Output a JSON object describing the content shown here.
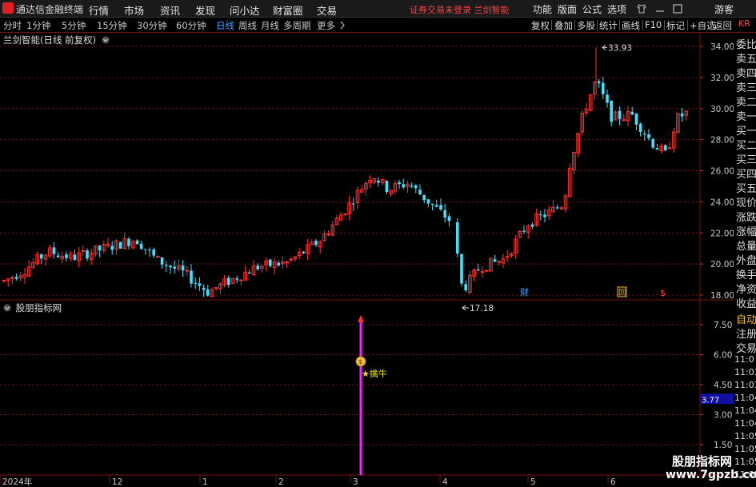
{
  "titlebar": {
    "app_name": "通达信金融终端",
    "menus": [
      "行情",
      "市场",
      "资讯",
      "发现",
      "问小达",
      "财富圈",
      "交易"
    ],
    "warning": "证券交易未登录  兰剑智能",
    "right_menus": [
      "功能",
      "版面",
      "公式",
      "选项"
    ],
    "user": "游客"
  },
  "periods": [
    "分时",
    "1分钟",
    "5分钟",
    "15分钟",
    "30分钟",
    "60分钟",
    "日线",
    "周线",
    "月线",
    "多周期",
    "更多"
  ],
  "active_period": "日线",
  "toolbar": [
    "复权",
    "叠加",
    "多股",
    "统计",
    "画线",
    "F10",
    "标记",
    "+自选",
    "返回"
  ],
  "kr_tag": "KR",
  "chart": {
    "title": "兰剑智能(日线 前复权)",
    "price_ticks": [
      "34.00",
      "32.00",
      "30.00",
      "28.00",
      "26.00",
      "24.00",
      "22.00",
      "20.00",
      "18.00"
    ],
    "high_label": "33.93",
    "low_label": "17.18",
    "markers": [
      "财",
      "回",
      "$"
    ],
    "colors": {
      "up": "#ff3030",
      "down": "#40e0ff",
      "grid": "#7a1010"
    }
  },
  "indicator": {
    "title": "股朋指标网",
    "ticks": [
      "7.50",
      "6.00",
      "4.50",
      "3.00",
      "1.50"
    ],
    "current_value": "3.77",
    "signal_label": "擒牛",
    "signal_star": "★",
    "bag_label": "$"
  },
  "date_axis": [
    "2024年",
    "12",
    "1",
    "2",
    "3",
    "4",
    "5",
    "6"
  ],
  "side_panel": {
    "items": [
      "委比",
      "卖五",
      "卖四",
      "卖三",
      "卖二",
      "卖一",
      "买一",
      "买二",
      "买三",
      "买四",
      "买五",
      "现价",
      "涨跌",
      "涨幅",
      "总量",
      "外盘",
      "换手",
      "净资",
      "收益"
    ],
    "lower_items": [
      "自动",
      "注册",
      "交易"
    ],
    "times": [
      "11:0",
      "11:03",
      "11:03",
      "11:04",
      "11:04",
      "11:04",
      "11:05",
      "11:05",
      "11:05",
      "11:05",
      "11:05"
    ]
  },
  "watermark": {
    "name": "股朋指标网",
    "url": "www.7gpzb.com"
  }
}
